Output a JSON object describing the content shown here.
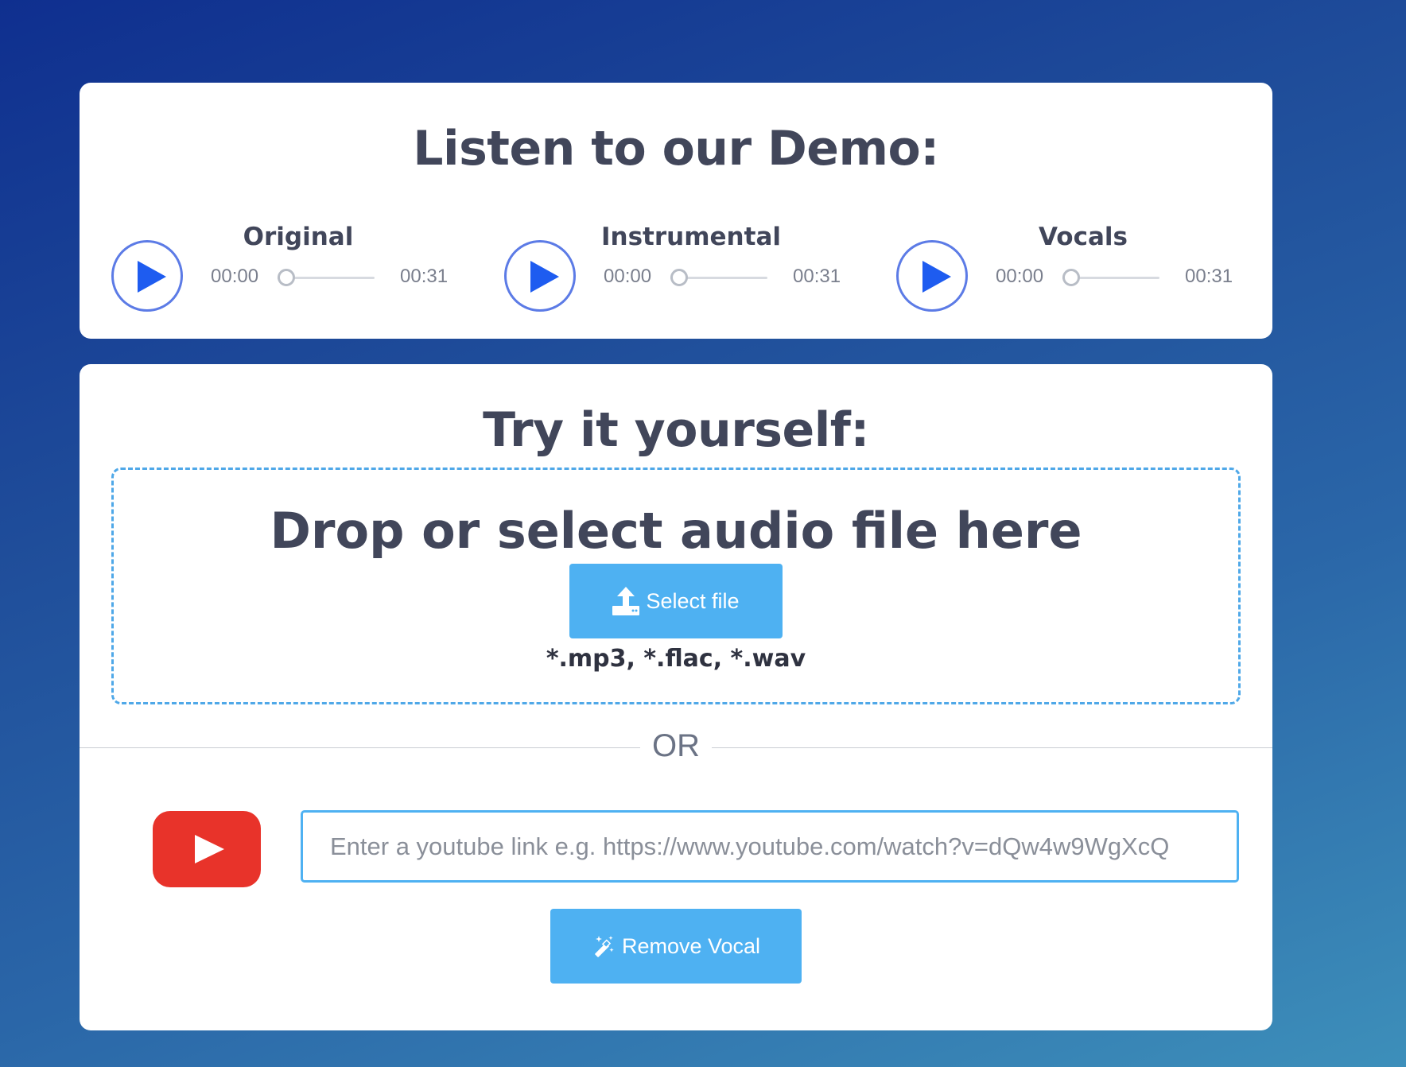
{
  "demo": {
    "title": "Listen to our Demo:",
    "players": [
      {
        "title": "Original",
        "current": "00:00",
        "total": "00:31",
        "progress": 0.1
      },
      {
        "title": "Instrumental",
        "current": "00:00",
        "total": "00:31",
        "progress": 0.1
      },
      {
        "title": "Vocals",
        "current": "00:00",
        "total": "00:31",
        "progress": 0.1
      }
    ]
  },
  "try": {
    "title": "Try it yourself:",
    "drop_title": "Drop or select audio file here",
    "select_label": "Select file",
    "formats": "*.mp3, *.flac, *.wav",
    "or_text": "OR",
    "youtube_placeholder": "Enter a youtube link e.g. https://www.youtube.com/watch?v=dQw4w9WgXcQ",
    "remove_label": "Remove Vocal"
  },
  "icons": {
    "play": "play-icon",
    "upload": "upload-icon",
    "youtube": "youtube-logo",
    "magic": "magic-wand-icon"
  },
  "colors": {
    "accent": "#4eb1f2",
    "play_ring": "#5c7be6",
    "play_fill": "#1e5cf0",
    "youtube_red": "#e8332a",
    "text_dark": "#41465a"
  }
}
